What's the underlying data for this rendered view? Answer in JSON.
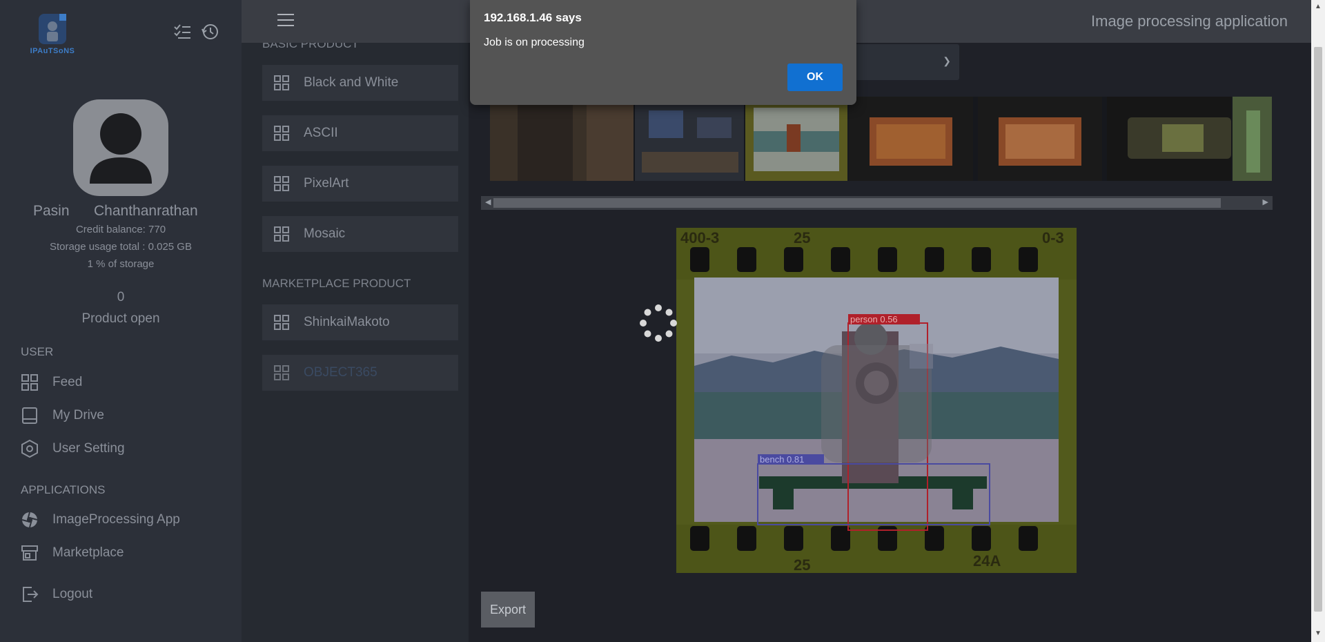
{
  "sidebar": {
    "logo_text": "IPAuTSoNS",
    "profile": {
      "first_name": "Pasin",
      "last_name": "Chanthanrathan",
      "credit_balance": "Credit balance: 770",
      "storage_usage": "Storage usage total : 0.025 GB",
      "storage_percent": "1 % of storage",
      "product_open_count": "0",
      "product_open_label": "Product open"
    },
    "user_section_label": "USER",
    "user_items": [
      {
        "label": "Feed",
        "icon": "grid-icon"
      },
      {
        "label": "My Drive",
        "icon": "drive-icon"
      },
      {
        "label": "User Setting",
        "icon": "settings-hex-icon"
      }
    ],
    "apps_section_label": "APPLICATIONS",
    "app_items": [
      {
        "label": "ImageProcessing App",
        "icon": "aperture-icon"
      },
      {
        "label": "Marketplace",
        "icon": "store-icon"
      }
    ],
    "logout_label": "Logout"
  },
  "products": {
    "basic_label": "BASIC PRODUCT",
    "basic_items": [
      "Black and White",
      "ASCII",
      "PixelArt",
      "Mosaic"
    ],
    "marketplace_label": "MARKETPLACE PRODUCT",
    "marketplace_items": [
      "ShinkaiMakoto",
      "OBJECT365"
    ]
  },
  "header": {
    "title": "Image processing application"
  },
  "result": {
    "detections": [
      {
        "label": "person 0.56"
      },
      {
        "label": "bench 0.81"
      }
    ],
    "film_numbers": [
      "400-3",
      "25",
      "0-3",
      "25",
      "24A"
    ]
  },
  "export_label": "Export",
  "alert": {
    "title": "192.168.1.46 says",
    "message": "Job is on processing",
    "ok_label": "OK"
  },
  "colors": {
    "sidebar_bg": "#2c3039",
    "accent_blue": "#1170d1",
    "person_box": "#b0202a",
    "bench_box": "#4a4aa0"
  }
}
